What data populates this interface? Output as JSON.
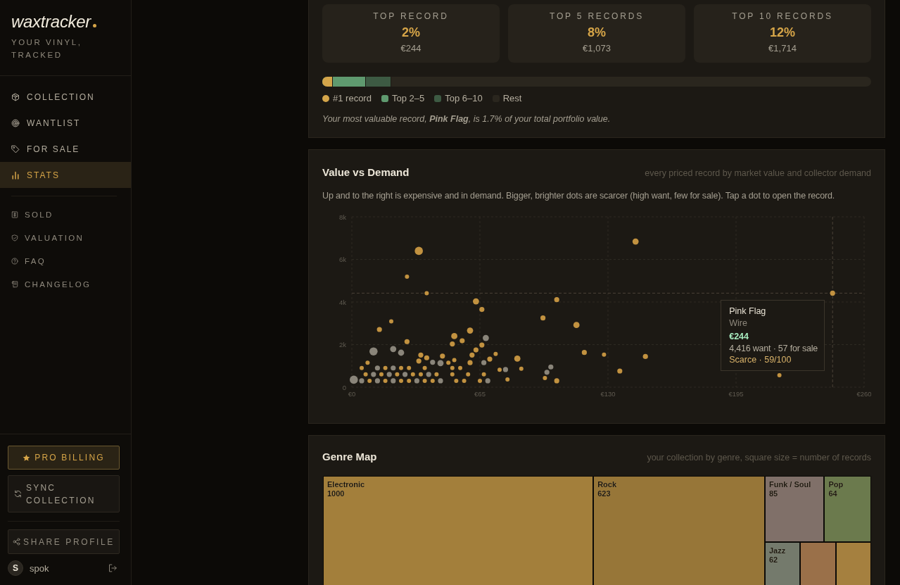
{
  "sidebar": {
    "logo": "waxtracker",
    "tagline": "YOUR VINYL, TRACKED",
    "nav": [
      {
        "label": "COLLECTION",
        "selected": false
      },
      {
        "label": "WANTLIST",
        "selected": false
      },
      {
        "label": "FOR SALE",
        "selected": false
      },
      {
        "label": "STATS",
        "selected": true
      }
    ],
    "secondary_nav": [
      {
        "label": "SOLD",
        "selected": false
      },
      {
        "label": "VALUATION",
        "selected": false
      },
      {
        "label": "FAQ",
        "selected": false
      },
      {
        "label": "CHANGELOG",
        "selected": false
      }
    ],
    "buttons": [
      {
        "label": "PRO BILLING",
        "kind": "pro"
      },
      {
        "label": "SYNC COLLECTION",
        "kind": "sync"
      },
      {
        "label": "SHARE PROFILE",
        "kind": "share"
      }
    ],
    "user": {
      "initial": "S",
      "name": "spok"
    }
  },
  "concentration": {
    "cards": [
      {
        "label": "TOP RECORD",
        "percent": "2%",
        "value": "€244"
      },
      {
        "label": "TOP 5 RECORDS",
        "percent": "8%",
        "value": "€1,073"
      },
      {
        "label": "TOP 10 RECORDS",
        "percent": "12%",
        "value": "€1,714"
      }
    ],
    "share_bar": {
      "fills": [
        {
          "level": 0.018,
          "color": "#d4a54a"
        },
        {
          "level": 0.078,
          "color": "#5f9a6f"
        },
        {
          "level": 0.124,
          "color": "#3d5a43"
        }
      ]
    },
    "legend": [
      {
        "label": "#1 record",
        "color": "#d4a54a"
      },
      {
        "label": "Top 2–5",
        "color": "#5f9a6f"
      },
      {
        "label": "Top 6–10",
        "color": "#3d5a43"
      },
      {
        "label": "Rest",
        "color": "#2a261e"
      }
    ],
    "note": "Your most valuable record, **Pink Flag**, is 1.7% of your total portfolio value."
  },
  "value_vs_demand": {
    "title": "Value vs Demand",
    "subtitle": "every priced record by market value and collector demand",
    "description": "Up and to the right is expensive and in demand. Bigger, brighter dots are scarcer (high want, few for sale). Tap a dot to open the record.",
    "chart_data": {
      "type": "scatter",
      "xlim": [
        0,
        260
      ],
      "ylim": [
        0,
        8000
      ],
      "xticks": [
        {
          "value": 0,
          "label": "€0"
        },
        {
          "value": 65,
          "label": "€65"
        },
        {
          "value": 130,
          "label": "€130"
        },
        {
          "value": 195,
          "label": "€195"
        },
        {
          "value": 260,
          "label": "€260"
        }
      ],
      "yticks": [
        {
          "value": 0,
          "label": "0"
        },
        {
          "value": 2000,
          "label": "2k"
        },
        {
          "value": 4000,
          "label": "4k"
        },
        {
          "value": 6000,
          "label": "6k"
        },
        {
          "value": 8000,
          "label": "8k"
        }
      ],
      "grid": true,
      "ref_lines": [
        {
          "axis": "x",
          "value": 244,
          "line_style": "dashed"
        },
        {
          "axis": "y",
          "value": 4416,
          "line_style": "dashed"
        }
      ],
      "series": [
        {
          "color": "#c29240",
          "x": [
            28,
            38,
            20,
            128,
            217,
            86,
            79,
            75,
            8,
            49,
            52,
            73,
            98,
            9,
            17,
            25,
            29,
            37,
            41,
            53,
            57,
            65,
            7,
            15,
            23,
            31,
            35,
            43,
            51,
            59,
            67,
            5,
            17,
            25,
            29,
            37,
            51,
            55
          ],
          "values": [
            5190,
            4410,
            3090,
            1530,
            560,
            870,
            360,
            820,
            1150,
            1150,
            1270,
            1560,
            430,
            300,
            300,
            300,
            300,
            300,
            300,
            300,
            300,
            300,
            600,
            600,
            600,
            600,
            600,
            600,
            600,
            600,
            600,
            900,
            900,
            900,
            900,
            900,
            900,
            900
          ]
        },
        {
          "color": "#c29240",
          "x": [
            244,
            66,
            104,
            97,
            14,
            56,
            51,
            66,
            28,
            118,
            149,
            136,
            104,
            35,
            34,
            38,
            46,
            61,
            63,
            60,
            70
          ],
          "values": [
            4416,
            3650,
            4110,
            3250,
            2710,
            2180,
            2030,
            1980,
            2140,
            1630,
            1440,
            760,
            300,
            1510,
            1230,
            1380,
            1460,
            1510,
            1750,
            1150,
            1320
          ]
        },
        {
          "color": "#c29240",
          "x": [
            144,
            63,
            114,
            60,
            52,
            84
          ],
          "values": [
            6840,
            4030,
            2920,
            2660,
            2400,
            1340
          ]
        },
        {
          "color": "#c29240",
          "x": [
            34
          ],
          "values": [
            6400
          ]
        },
        {
          "color": "#8a857a",
          "x": [
            99,
            101,
            78,
            41,
            67,
            5,
            13,
            21,
            33,
            45,
            69,
            11,
            19,
            27,
            39,
            13,
            21
          ],
          "values": [
            700,
            950,
            830,
            1170,
            1150,
            300,
            300,
            300,
            300,
            300,
            300,
            600,
            600,
            600,
            600,
            900,
            900
          ]
        },
        {
          "color": "#8a857a",
          "x": [
            68,
            21,
            25,
            45
          ],
          "values": [
            2310,
            1790,
            1620,
            1130
          ]
        },
        {
          "color": "#8a857a",
          "x": [
            1,
            11
          ],
          "values": [
            350,
            1680
          ]
        }
      ]
    },
    "tooltip": {
      "title": "Pink Flag",
      "artist": "Wire",
      "price": "€244",
      "demand": "4,416 want · 57 for sale",
      "scarcity": "Scarce · 59/100"
    }
  },
  "genre_map": {
    "title": "Genre Map",
    "subtitle": "your collection by genre, square size = number of records",
    "cells": [
      {
        "name": "Electronic",
        "count": "1000",
        "color": "#a37f3b"
      },
      {
        "name": "Rock",
        "count": "623",
        "color": "#977638"
      },
      {
        "name": "Funk / Soul",
        "count": "85",
        "color": "#807069"
      },
      {
        "name": "Pop",
        "count": "64",
        "color": "#6b7a4d"
      },
      {
        "name": "Jazz",
        "count": "62",
        "color": "#747a6c"
      },
      {
        "color": "#9a7049"
      },
      {
        "color": "#a5803f"
      }
    ]
  }
}
